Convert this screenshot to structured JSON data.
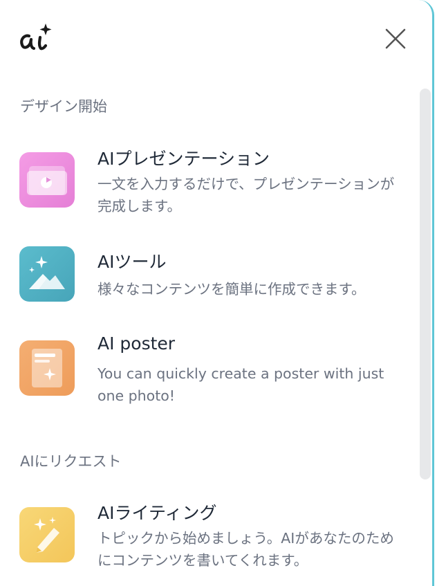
{
  "header": {
    "logo_icon": "ai-sparkle-logo",
    "close_icon": "close-icon"
  },
  "sections": [
    {
      "title": "デザイン開始",
      "items": [
        {
          "title": "AIプレゼンテーション",
          "description": "一文を入力するだけで、プレゼンテーションが完成します。",
          "icon": "presentation-icon",
          "color": "#ef8fdf"
        },
        {
          "title": "AIツール",
          "description": "様々なコンテンツを簡単に作成できます。",
          "icon": "image-sparkle-icon",
          "color": "#52b1c4"
        },
        {
          "title": "AI poster",
          "description": "You can quickly create a poster with just one photo!",
          "icon": "poster-icon",
          "color": "#f1a766"
        }
      ]
    },
    {
      "title": "AIにリクエスト",
      "items": [
        {
          "title": "AIライティング",
          "description": "トピックから始めましょう。AIがあなたのためにコンテンツを書いてくれます。",
          "icon": "pen-sparkle-icon",
          "color": "#f6cf6a"
        }
      ]
    }
  ],
  "colors": {
    "accent_border": "#5fc6d6",
    "title_text": "#1f2937",
    "secondary_text": "#6b7280"
  }
}
